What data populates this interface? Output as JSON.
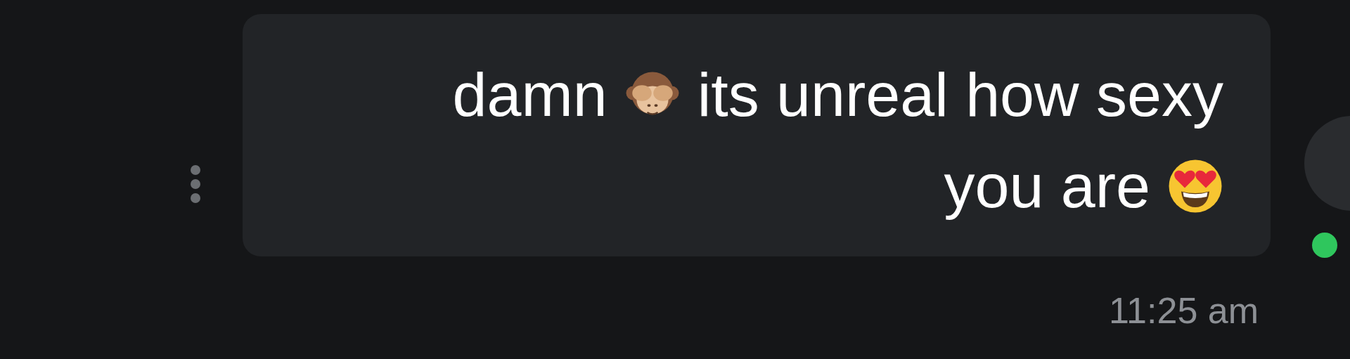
{
  "contact": {
    "online": true
  },
  "message": {
    "lines": [
      {
        "parts": [
          {
            "kind": "text",
            "text": "damn"
          },
          {
            "kind": "monkey"
          },
          {
            "kind": "text",
            "text": "its unreal how sexy"
          }
        ]
      },
      {
        "parts": [
          {
            "kind": "text",
            "text": "you are"
          },
          {
            "kind": "heart_eyes"
          }
        ]
      }
    ],
    "time": "11:25 am"
  }
}
